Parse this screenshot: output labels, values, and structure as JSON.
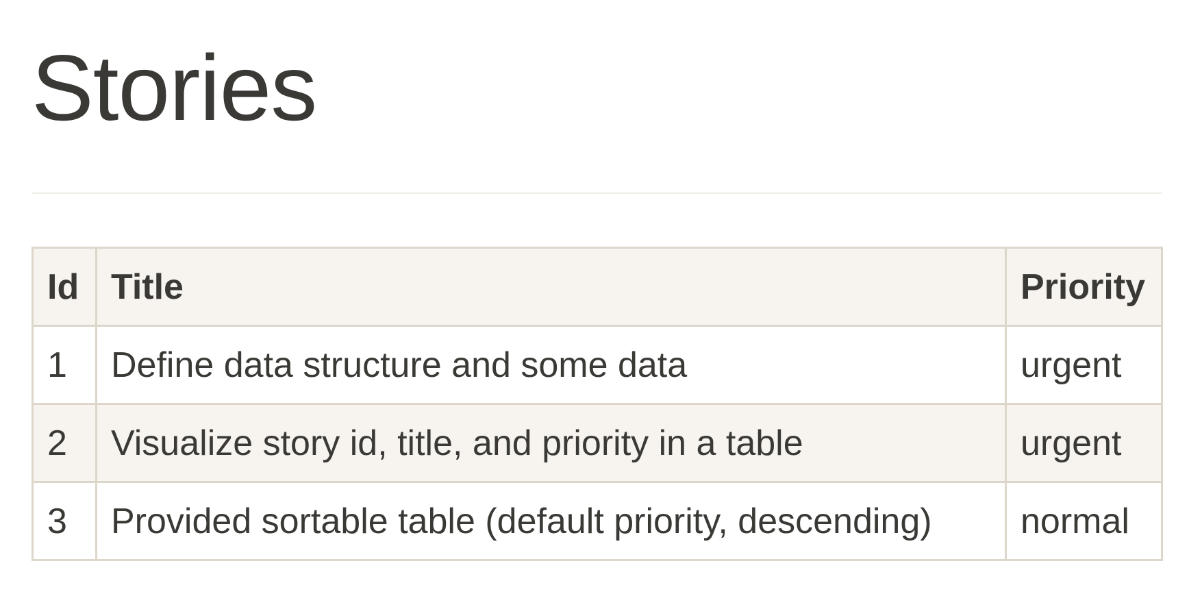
{
  "page": {
    "title": "Stories"
  },
  "table": {
    "headers": {
      "id": "Id",
      "title": "Title",
      "priority": "Priority"
    },
    "rows": [
      {
        "id": "1",
        "title": "Define data structure and some data",
        "priority": "urgent"
      },
      {
        "id": "2",
        "title": "Visualize story id, title, and priority in a table",
        "priority": "urgent"
      },
      {
        "id": "3",
        "title": "Provided sortable table (default priority, descending)",
        "priority": "normal"
      }
    ]
  },
  "colors": {
    "text": "#3a3935",
    "border": "#ddd6cb",
    "header_bg": "#f7f4ef",
    "stripe_bg": "#f7f4ef",
    "divider": "#f0ede7"
  }
}
